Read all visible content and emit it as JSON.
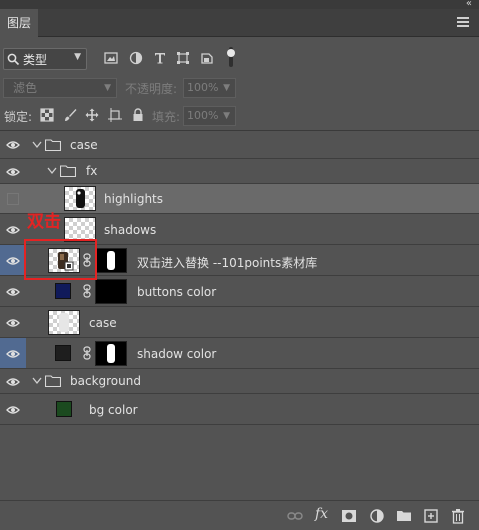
{
  "panel": {
    "collapse_glyph": "«",
    "tab_label": "图层"
  },
  "filter": {
    "kind_label": "类型",
    "icons": [
      "search-icon",
      "image-filter-icon",
      "adjustment-filter-icon",
      "type-filter-icon",
      "shape-filter-icon",
      "smart-object-filter-icon",
      "filter-toggle-icon"
    ]
  },
  "blend": {
    "mode": "滤色",
    "opacity_label": "不透明度:",
    "opacity_value": "100%"
  },
  "lock": {
    "label": "锁定:",
    "fill_label": "填充:",
    "fill_value": "100%",
    "icons": [
      "lock-transparent-icon",
      "lock-paint-icon",
      "lock-move-icon",
      "lock-artboard-icon",
      "lock-all-icon"
    ]
  },
  "layers": [
    {
      "name": "case",
      "type": "group",
      "visible": true
    },
    {
      "name": "fx",
      "type": "group",
      "visible": true
    },
    {
      "name": "highlights",
      "type": "layer",
      "visible": false,
      "selected": true
    },
    {
      "name": "shadows",
      "type": "layer",
      "visible": true
    },
    {
      "name": "双击进入替换 --101points素材库",
      "type": "smart-object",
      "visible": true,
      "highlighted": true
    },
    {
      "name": "buttons color",
      "type": "fill",
      "visible": true,
      "color": "#101a5a"
    },
    {
      "name": "case",
      "type": "layer",
      "visible": true
    },
    {
      "name": "shadow color",
      "type": "fill",
      "visible": true,
      "highlighted": true,
      "color": "#1e1e1e"
    },
    {
      "name": "background",
      "type": "group",
      "visible": true
    },
    {
      "name": "bg color",
      "type": "fill",
      "visible": true,
      "color": "#1b4a1f"
    }
  ],
  "annotation": {
    "text": "双击",
    "color": "#e42323"
  },
  "bottom_icons": [
    "link-layers-icon",
    "fx-icon",
    "add-mask-icon",
    "adjustment-layer-icon",
    "new-group-icon",
    "new-layer-icon",
    "delete-icon"
  ],
  "bottom_fx_label": "fx",
  "colors": {
    "panel_bg": "#535353",
    "selected_row": "#6a6a6a",
    "eye_highlight": "#516a91"
  }
}
